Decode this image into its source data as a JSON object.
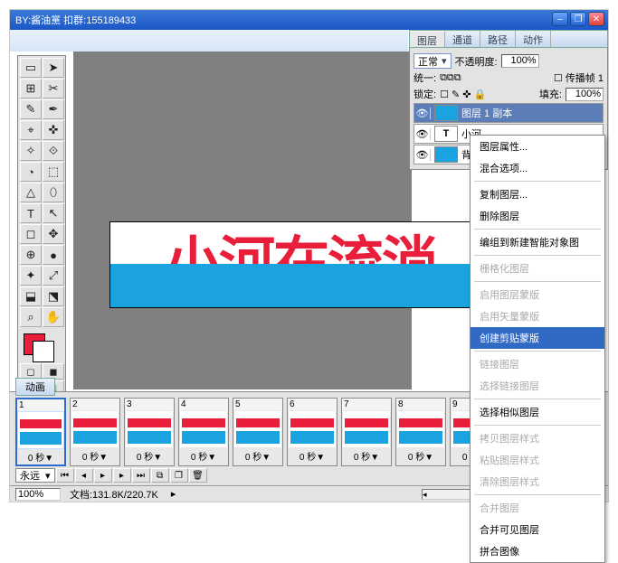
{
  "watermark": "BY:酱油黨 扣群:155189433",
  "window_controls": {
    "min": "–",
    "max": "❐",
    "close": "✕"
  },
  "panels": {
    "tabs": [
      "图层",
      "通道",
      "路径",
      "动作"
    ],
    "blend_mode": "正常",
    "opacity_label": "不透明度:",
    "opacity_value": "100%",
    "unify_label": "统一:",
    "propagate_label": "传播帧 1",
    "lock_label": "锁定:",
    "fill_label": "填充:",
    "fill_value": "100%",
    "layers": [
      {
        "name": "图层 1 副本",
        "selected": true,
        "thumb": "shape"
      },
      {
        "name": "小河",
        "selected": false,
        "thumb": "T"
      },
      {
        "name": "背",
        "selected": false,
        "thumb": "shape"
      }
    ]
  },
  "context_menu": {
    "items": [
      {
        "label": "图层属性...",
        "enabled": true
      },
      {
        "label": "混合选项...",
        "enabled": true
      },
      {
        "sep": true
      },
      {
        "label": "复制图层...",
        "enabled": true
      },
      {
        "label": "删除图层",
        "enabled": true
      },
      {
        "sep": true
      },
      {
        "label": "编组到新建智能对象图",
        "enabled": true
      },
      {
        "sep": true
      },
      {
        "label": "栅格化图层",
        "enabled": false
      },
      {
        "sep": true
      },
      {
        "label": "启用图层蒙版",
        "enabled": false
      },
      {
        "label": "启用矢量蒙版",
        "enabled": false
      },
      {
        "label": "创建剪贴蒙版",
        "enabled": true,
        "selected": true
      },
      {
        "sep": true
      },
      {
        "label": "链接图层",
        "enabled": false
      },
      {
        "label": "选择链接图层",
        "enabled": false
      },
      {
        "sep": true
      },
      {
        "label": "选择相似图层",
        "enabled": true
      },
      {
        "sep": true
      },
      {
        "label": "拷贝图层样式",
        "enabled": false
      },
      {
        "label": "粘贴图层样式",
        "enabled": false
      },
      {
        "label": "清除图层样式",
        "enabled": false
      },
      {
        "sep": true
      },
      {
        "label": "合并图层",
        "enabled": false
      },
      {
        "label": "合并可见图层",
        "enabled": true
      },
      {
        "label": "拼合图像",
        "enabled": true
      }
    ]
  },
  "canvas": {
    "text": "小河在流淌"
  },
  "animation": {
    "tab": "动画",
    "frame_delay": "0 秒▼",
    "loop": "永远",
    "frame_count": 9
  },
  "status": {
    "zoom": "100%",
    "doc": "文档:131.8K/220.7K"
  },
  "tools": [
    "▭",
    "➤",
    "⊞",
    "✂",
    "✎",
    "✒",
    "⌖",
    "✜",
    "✧",
    "⟐",
    "◔",
    "⬚",
    "△",
    "⬯",
    "T",
    "↖",
    "◻",
    "✥",
    "⊕",
    "●",
    "✦",
    "⤢",
    "⬓",
    "⬔",
    "⌕",
    "✋"
  ]
}
